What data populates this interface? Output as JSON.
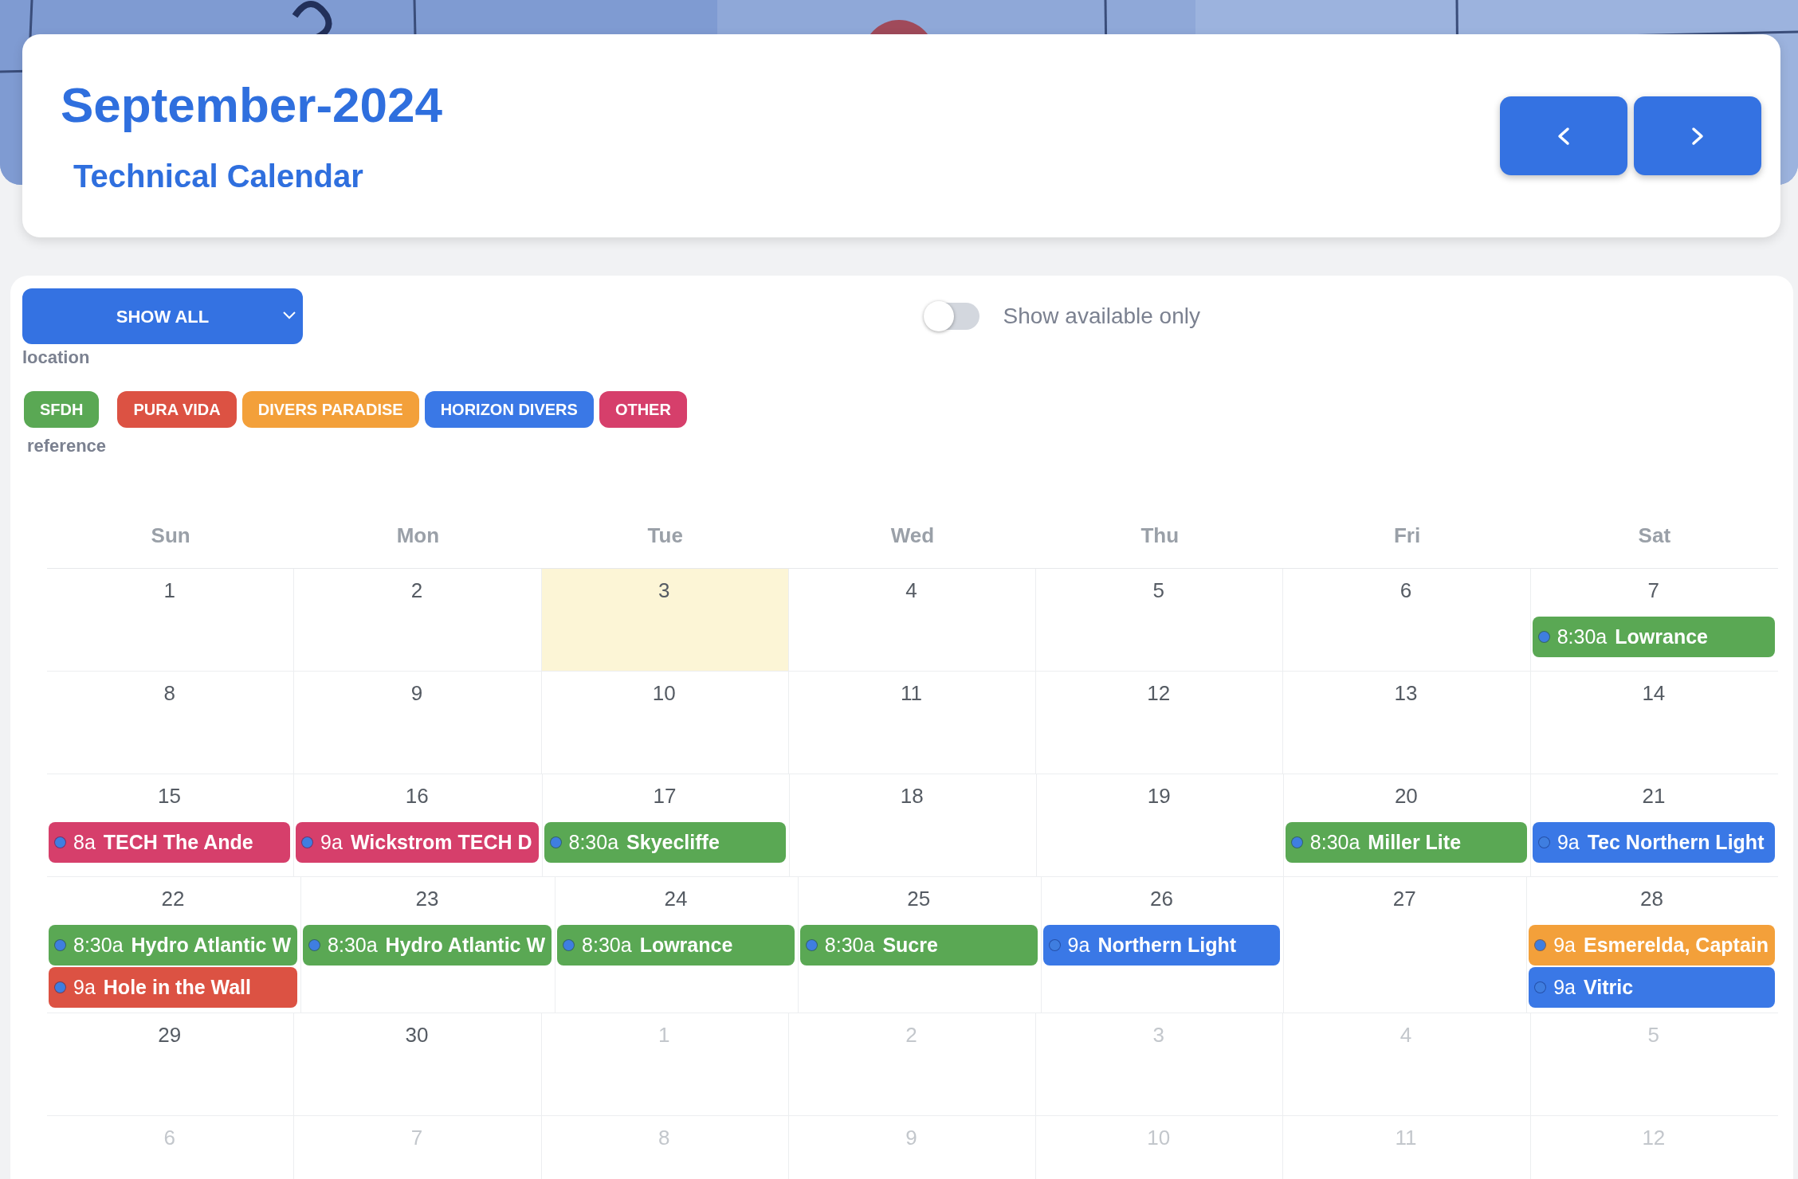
{
  "header": {
    "title": "September-2024",
    "subtitle": "Technical Calendar"
  },
  "nav_buttons": [
    {
      "kind": "prev"
    },
    {
      "kind": "next"
    }
  ],
  "filter": {
    "value": "SHOW ALL",
    "label": "location"
  },
  "toggle": {
    "label": "Show available only",
    "on": false
  },
  "legend": {
    "label": "reference",
    "items": [
      {
        "label": "SFDH",
        "color": "#5aa854"
      },
      {
        "label": "PURA VIDA",
        "color": "#dc5243"
      },
      {
        "label": "DIVERS PARADISE",
        "color": "#f3a03a"
      },
      {
        "label": "HORIZON DIVERS",
        "color": "#3a78e6"
      },
      {
        "label": "OTHER",
        "color": "#d63f6b"
      }
    ]
  },
  "weekdays": [
    "Sun",
    "Mon",
    "Tue",
    "Wed",
    "Thu",
    "Fri",
    "Sat"
  ],
  "weeks": [
    {
      "days": [
        {
          "day": "1",
          "today": false,
          "outside": false
        },
        {
          "day": "2",
          "today": false,
          "outside": false
        },
        {
          "day": "3",
          "today": true,
          "outside": false
        },
        {
          "day": "4",
          "today": false,
          "outside": false
        },
        {
          "day": "5",
          "today": false,
          "outside": false
        },
        {
          "day": "6",
          "today": false,
          "outside": false
        },
        {
          "day": "7",
          "today": false,
          "outside": false,
          "events": [
            {
              "time": "8:30a",
              "title": "Lowrance",
              "color": "#5aa854"
            }
          ]
        }
      ]
    },
    {
      "days": [
        {
          "day": "8",
          "today": false,
          "outside": false
        },
        {
          "day": "9",
          "today": false,
          "outside": false
        },
        {
          "day": "10",
          "today": false,
          "outside": false
        },
        {
          "day": "11",
          "today": false,
          "outside": false
        },
        {
          "day": "12",
          "today": false,
          "outside": false
        },
        {
          "day": "13",
          "today": false,
          "outside": false
        },
        {
          "day": "14",
          "today": false,
          "outside": false
        }
      ]
    },
    {
      "days": [
        {
          "day": "15",
          "today": false,
          "outside": false,
          "events": [
            {
              "time": "8a",
              "title": "TECH The Ande",
              "color": "#d63f6b"
            }
          ]
        },
        {
          "day": "16",
          "today": false,
          "outside": false,
          "events": [
            {
              "time": "9a",
              "title": "Wickstrom TECH D",
              "color": "#d63f6b"
            }
          ]
        },
        {
          "day": "17",
          "today": false,
          "outside": false,
          "events": [
            {
              "time": "8:30a",
              "title": "Skyecliffe",
              "color": "#5aa854"
            }
          ]
        },
        {
          "day": "18",
          "today": false,
          "outside": false
        },
        {
          "day": "19",
          "today": false,
          "outside": false
        },
        {
          "day": "20",
          "today": false,
          "outside": false,
          "events": [
            {
              "time": "8:30a",
              "title": "Miller Lite",
              "color": "#5aa854"
            }
          ]
        },
        {
          "day": "21",
          "today": false,
          "outside": false,
          "events": [
            {
              "time": "9a",
              "title": "Tec Northern Light",
              "color": "#3a78e6"
            }
          ]
        }
      ]
    },
    {
      "days": [
        {
          "day": "22",
          "today": false,
          "outside": false,
          "events": [
            {
              "time": "8:30a",
              "title": "Hydro Atlantic W",
              "color": "#5aa854"
            },
            {
              "time": "9a",
              "title": "Hole in the Wall",
              "color": "#dc5243"
            }
          ]
        },
        {
          "day": "23",
          "today": false,
          "outside": false,
          "events": [
            {
              "time": "8:30a",
              "title": "Hydro Atlantic W",
              "color": "#5aa854"
            }
          ]
        },
        {
          "day": "24",
          "today": false,
          "outside": false,
          "events": [
            {
              "time": "8:30a",
              "title": "Lowrance",
              "color": "#5aa854"
            }
          ]
        },
        {
          "day": "25",
          "today": false,
          "outside": false,
          "events": [
            {
              "time": "8:30a",
              "title": "Sucre",
              "color": "#5aa854"
            }
          ]
        },
        {
          "day": "26",
          "today": false,
          "outside": false,
          "events": [
            {
              "time": "9a",
              "title": "Northern Light",
              "color": "#3a78e6"
            }
          ]
        },
        {
          "day": "27",
          "today": false,
          "outside": false
        },
        {
          "day": "28",
          "today": false,
          "outside": false,
          "events": [
            {
              "time": "9a",
              "title": "Esmerelda, Captain",
              "color": "#f3a03a"
            },
            {
              "time": "9a",
              "title": "Vitric",
              "color": "#3a78e6"
            }
          ]
        }
      ]
    },
    {
      "days": [
        {
          "day": "29",
          "today": false,
          "outside": false
        },
        {
          "day": "30",
          "today": false,
          "outside": false
        },
        {
          "day": "1",
          "today": false,
          "outside": true
        },
        {
          "day": "2",
          "today": false,
          "outside": true
        },
        {
          "day": "3",
          "today": false,
          "outside": true
        },
        {
          "day": "4",
          "today": false,
          "outside": true
        },
        {
          "day": "5",
          "today": false,
          "outside": true
        }
      ]
    },
    {
      "days": [
        {
          "day": "6",
          "today": false,
          "outside": true
        },
        {
          "day": "7",
          "today": false,
          "outside": true
        },
        {
          "day": "8",
          "today": false,
          "outside": true
        },
        {
          "day": "9",
          "today": false,
          "outside": true
        },
        {
          "day": "10",
          "today": false,
          "outside": true
        },
        {
          "day": "11",
          "today": false,
          "outside": true
        },
        {
          "day": "12",
          "today": false,
          "outside": true
        }
      ]
    }
  ]
}
